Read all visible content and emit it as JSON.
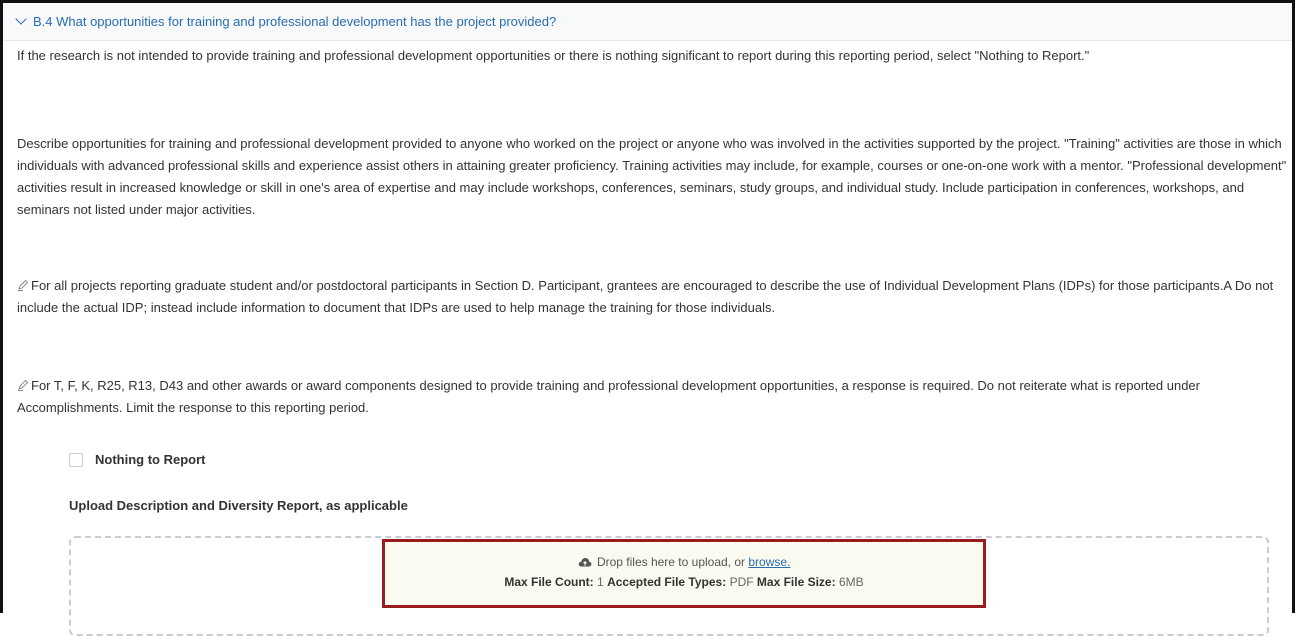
{
  "section": {
    "title": "B.4 What opportunities for training and professional development has the project provided?"
  },
  "paragraphs": {
    "intro": "If the research is not intended to provide training and professional development opportunities or there is nothing significant to report during this reporting period, select \"Nothing to Report.\"",
    "describe": "Describe opportunities for training and professional development provided to anyone who worked on the project or anyone who was involved in the activities supported by the project. \"Training\" activities are those in which individuals with advanced professional skills and experience assist others in attaining greater proficiency. Training activities may include, for example, courses or one-on-one work with a mentor. \"Professional development\" activities result in increased knowledge or skill in one's area of expertise and may include workshops, conferences, seminars, study groups, and individual study. Include participation in conferences, workshops, and seminars not listed under major activities.",
    "note_idp": "For all projects reporting graduate student and/or postdoctoral participants in Section D. Participant, grantees are encouraged to describe the use of Individual Development Plans (IDPs) for those participants.A Do not include the actual IDP; instead include information to document that IDPs are used to help manage the training for those individuals.",
    "note_awards": "For T, F, K, R25, R13, D43 and other awards or award components designed to provide training and professional development opportunities, a response is required. Do not reiterate what is reported under Accomplishments. Limit the response to this reporting period."
  },
  "nothing_to_report": {
    "label": "Nothing to Report",
    "checked": false
  },
  "upload": {
    "label": "Upload Description and Diversity Report, as applicable",
    "drop_text": "Drop files here to upload, or",
    "browse_text": "browse.",
    "max_count_label": "Max File Count:",
    "max_count_value": "1",
    "types_label": "Accepted File Types:",
    "types_value": "PDF",
    "size_label": "Max File Size:",
    "size_value": "6MB"
  },
  "icons": {
    "chevron": "chevron-down-icon",
    "note": "pencil-note-icon",
    "cloud": "cloud-upload-icon"
  },
  "colors": {
    "link": "#2b6cb0",
    "highlight_border": "#9b1c1c"
  }
}
